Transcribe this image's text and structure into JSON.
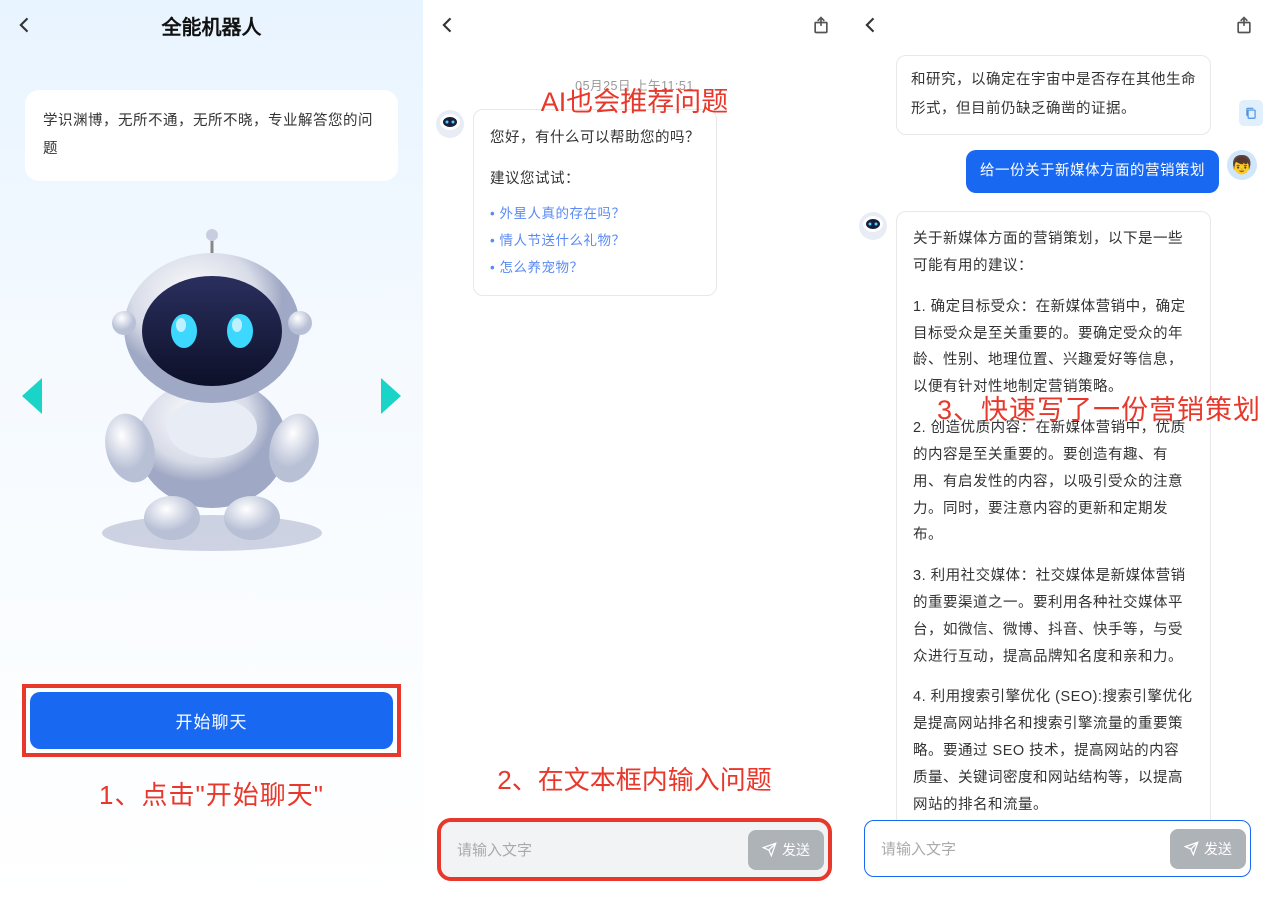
{
  "panel1": {
    "title": "全能机器人",
    "description": "学识渊博，无所不通，无所不晓，专业解答您的问题",
    "start_button": "开始聊天",
    "annotation": "1、点击\"开始聊天\""
  },
  "panel2": {
    "timestamp": "05月25日  上午11:51",
    "top_annotation": "AI也会推荐问题",
    "bot_greeting": "您好，有什么可以帮助您的吗？",
    "try_label": "建议您试试：",
    "suggestions": [
      "外星人真的存在吗？",
      "情人节送什么礼物？",
      "怎么养宠物？"
    ],
    "input_placeholder": "请输入文字",
    "send_label": "发送",
    "annotation": "2、在文本框内输入问题"
  },
  "panel3": {
    "bot_msg_partial": "和研究，以确定在宇宙中是否存在其他生命形式，但目前仍缺乏确凿的证据。",
    "user_msg": "给一份关于新媒体方面的营销策划",
    "bot_reply_intro": "关于新媒体方面的营销策划，以下是一些可能有用的建议：",
    "bot_reply_points": [
      "1. 确定目标受众：在新媒体营销中，确定目标受众是至关重要的。要确定受众的年龄、性别、地理位置、兴趣爱好等信息，以便有针对性地制定营销策略。",
      "2. 创造优质内容：在新媒体营销中，优质的内容是至关重要的。要创造有趣、有用、有启发性的内容，以吸引受众的注意力。同时，要注意内容的更新和定期发布。",
      "3. 利用社交媒体：社交媒体是新媒体营销的重要渠道之一。要利用各种社交媒体平台，如微信、微博、抖音、快手等，与受众进行互动，提高品牌知名度和亲和力。",
      "4. 利用搜索引擎优化 (SEO):搜索引擎优化是提高网站排名和搜索引擎流量的重要策略。要通过 SEO 技术，提高网站的内容质量、关键词密度和网站结构等，以提高网站的排名和流量。"
    ],
    "annotation": "3、快速写了一份营销策划",
    "input_placeholder": "请输入文字",
    "send_label": "发送"
  }
}
